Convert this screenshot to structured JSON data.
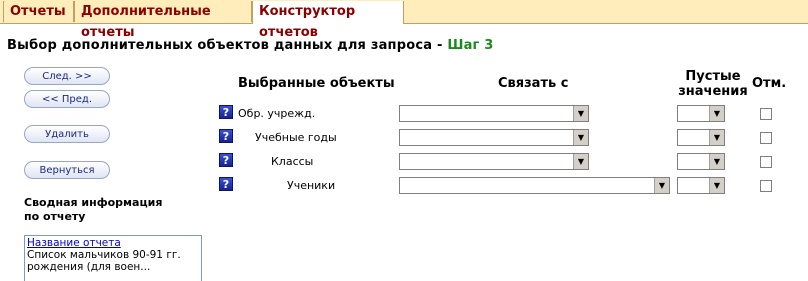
{
  "tabs": [
    {
      "label": "Отчеты",
      "active": false
    },
    {
      "label": "Дополнительные отчеты",
      "active": false
    },
    {
      "label": "Конструктор отчетов",
      "active": true
    }
  ],
  "page": {
    "title": "Выбор дополнительных объектов данных для запроса - ",
    "step": "Шаг 3"
  },
  "buttons": {
    "next": "След. >>",
    "prev": "<< Пред.",
    "delete": "Удалить",
    "back": "Вернуться"
  },
  "columns": {
    "selected": "Выбранные объекты",
    "link": "Связать с",
    "nulls_line1": "Пустые",
    "nulls_line2": "значения",
    "mark": "Отм."
  },
  "rows": [
    {
      "label": "Обр. учрежд.",
      "help": "?"
    },
    {
      "label": "Учебные годы",
      "help": "?"
    },
    {
      "label": "Классы",
      "help": "?"
    },
    {
      "label": "Ученики",
      "help": "?"
    }
  ],
  "summary": {
    "title_line1": "Сводная информация",
    "title_line2": "по отчету",
    "link": "Название отчета",
    "text_line1": "Список мальчиков 90-91 гг.",
    "text_line2": "рождения (для воен..."
  },
  "icons": {
    "help": "help-icon",
    "dropdown": "chevron-down-icon"
  },
  "colors": {
    "tab_bg": "#ffeebb",
    "tab_text": "#8b0000",
    "step": "#1a8a1a",
    "button_text": "#1a2a80"
  }
}
